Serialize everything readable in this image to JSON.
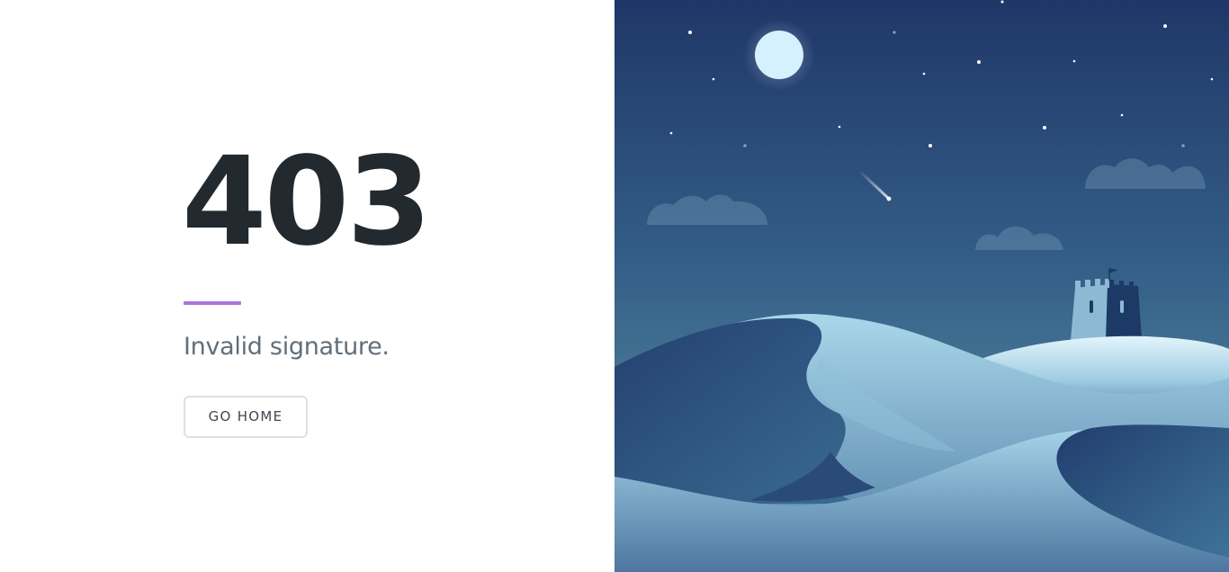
{
  "error": {
    "code": "403",
    "message": "Invalid signature."
  },
  "actions": {
    "home_label": "GO HOME"
  },
  "illustration": {
    "scene": "night-desert-castle",
    "icons": [
      "moon-icon",
      "stars-icon",
      "shooting-star-icon",
      "cloud-icon",
      "castle-icon",
      "flag-icon",
      "sand-dunes"
    ]
  },
  "colors": {
    "accent": "#a875da",
    "code_text": "#22292f",
    "message_text": "#606f7b",
    "button_border": "#dae1e7",
    "button_text": "#3d4852",
    "sky_top": "#1f3768",
    "sky_bottom": "#5d95a8",
    "moon": "#d5f1fd"
  }
}
